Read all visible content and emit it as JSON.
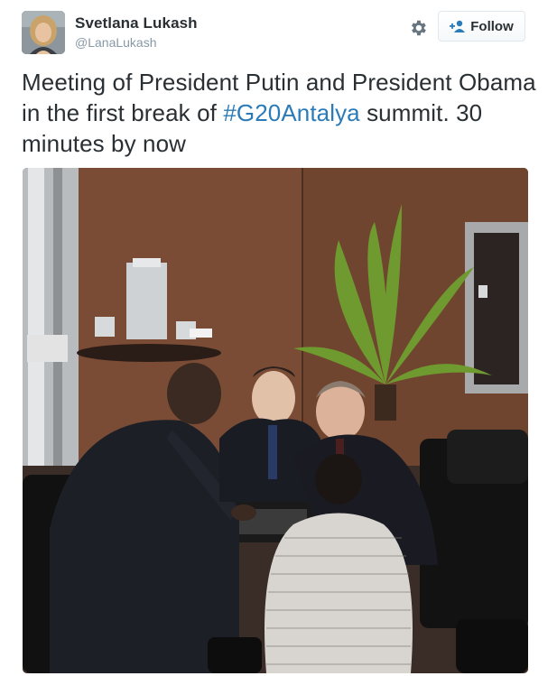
{
  "tweet": {
    "display_name": "Svetlana Lukash",
    "screen_name": "@LanaLukash",
    "text_before": "Meeting of President Putin and President Obama in the first break of ",
    "hashtag": "#G20Antalya",
    "text_after": " summit. 30 minutes by now"
  },
  "actions": {
    "follow_label": "Follow",
    "settings_icon": "gear-icon",
    "follow_icon": "person-plus-icon"
  },
  "colors": {
    "name": "#292f33",
    "muted": "#8899a6",
    "link": "#2b7bb9",
    "button_border": "#e1e8ed"
  }
}
